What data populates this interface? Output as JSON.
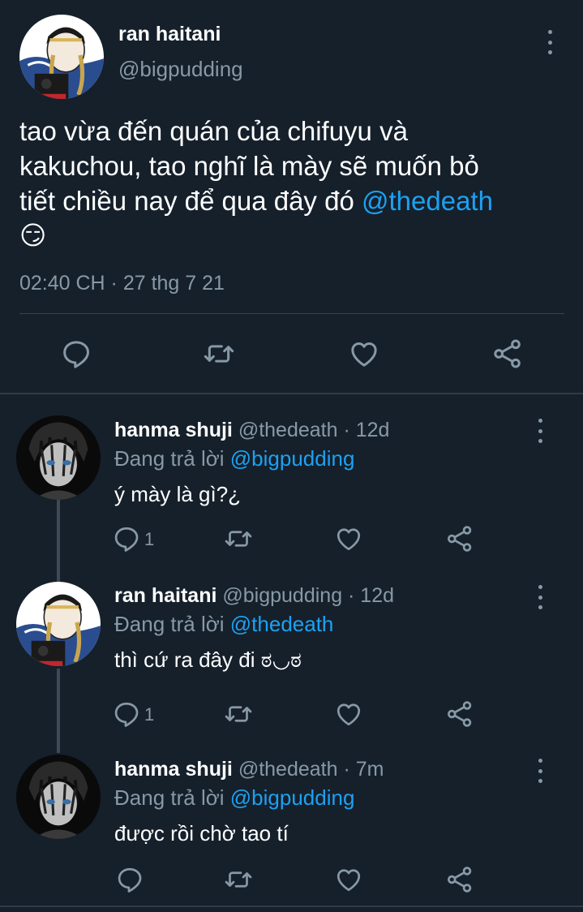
{
  "main_tweet": {
    "display_name": "ran haitani",
    "handle": "@bigpudding",
    "text_lines": [
      "tao vừa đến quán của chifuyu và",
      "kakuchou, tao nghĩ là mày sẽ muốn bỏ",
      "tiết chiều nay để qua đây đó "
    ],
    "mention": "@thedeath",
    "emoji": "😏",
    "timestamp": "02:40 CH · 27 thg 7 21"
  },
  "replies": [
    {
      "display_name": "hanma shuji",
      "handle_time": "@thedeath · 12d",
      "replying_prefix": "Đang trả lời ",
      "replying_to": "@bigpudding",
      "text": "ý mày là gì?¿",
      "reply_count": "1"
    },
    {
      "display_name": "ran haitani",
      "handle_time": "@bigpudding · 12d",
      "replying_prefix": "Đang trả lời ",
      "replying_to": "@thedeath",
      "text": "thì cứ ra đây đi ಠ◡ಠ",
      "reply_count": "1"
    },
    {
      "display_name": "hanma shuji",
      "handle_time": "@thedeath · 7m",
      "replying_prefix": "Đang trả lời ",
      "replying_to": "@bigpudding",
      "text": "được rồi chờ tao tí",
      "reply_count": ""
    }
  ],
  "icons": [
    "reply-icon",
    "retweet-icon",
    "like-icon",
    "share-icon",
    "more-options-icon"
  ],
  "colors": {
    "background": "#15202b",
    "text": "#ffffff",
    "muted": "#8899a6",
    "link": "#1da1f2",
    "divider": "#38444d"
  }
}
